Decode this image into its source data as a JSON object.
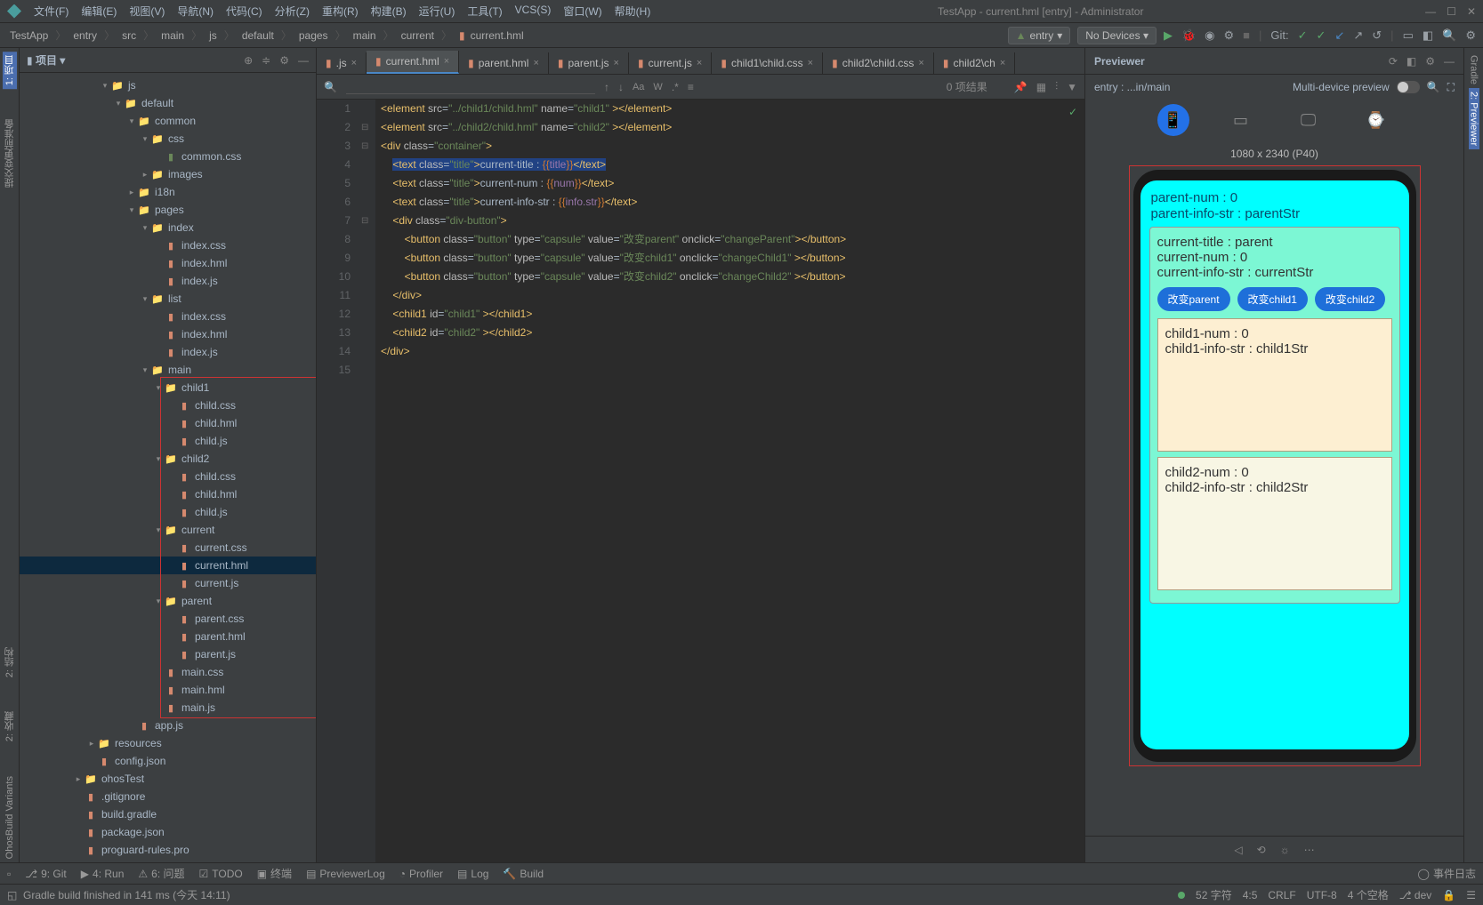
{
  "titlebar": {
    "title": "TestApp - current.hml [entry] - Administrator"
  },
  "menu": [
    "文件(F)",
    "编辑(E)",
    "视图(V)",
    "导航(N)",
    "代码(C)",
    "分析(Z)",
    "重构(R)",
    "构建(B)",
    "运行(U)",
    "工具(T)",
    "VCS(S)",
    "窗口(W)",
    "帮助(H)"
  ],
  "breadcrumb": [
    "TestApp",
    "entry",
    "src",
    "main",
    "js",
    "default",
    "pages",
    "main",
    "current",
    "current.hml"
  ],
  "right_tools": {
    "entry": "entry",
    "devices": "No Devices ▾",
    "git": "Git:"
  },
  "left_rail": [
    "1: 项目",
    "提交变更前准备",
    "2: 结构",
    "2: 收藏",
    "OhosBuild Variants"
  ],
  "right_rail": [
    "Gradle",
    "2: Previewer"
  ],
  "project": {
    "title": "项目 ▾"
  },
  "tree": [
    {
      "indent": 90,
      "caret": "▾",
      "ico": "folder",
      "name": "js"
    },
    {
      "indent": 105,
      "caret": "▾",
      "ico": "folder",
      "name": "default"
    },
    {
      "indent": 120,
      "caret": "▾",
      "ico": "folder",
      "name": "common"
    },
    {
      "indent": 135,
      "caret": "▾",
      "ico": "folder",
      "name": "css"
    },
    {
      "indent": 150,
      "caret": "",
      "ico": "css",
      "name": "common.css",
      "green": true
    },
    {
      "indent": 135,
      "caret": "▸",
      "ico": "folder",
      "name": "images"
    },
    {
      "indent": 120,
      "caret": "▸",
      "ico": "folder",
      "name": "i18n"
    },
    {
      "indent": 120,
      "caret": "▾",
      "ico": "folder",
      "name": "pages"
    },
    {
      "indent": 135,
      "caret": "▾",
      "ico": "folder",
      "name": "index"
    },
    {
      "indent": 150,
      "caret": "",
      "ico": "css",
      "name": "index.css"
    },
    {
      "indent": 150,
      "caret": "",
      "ico": "hml",
      "name": "index.hml"
    },
    {
      "indent": 150,
      "caret": "",
      "ico": "js",
      "name": "index.js"
    },
    {
      "indent": 135,
      "caret": "▾",
      "ico": "folder",
      "name": "list"
    },
    {
      "indent": 150,
      "caret": "",
      "ico": "css",
      "name": "index.css"
    },
    {
      "indent": 150,
      "caret": "",
      "ico": "hml",
      "name": "index.hml"
    },
    {
      "indent": 150,
      "caret": "",
      "ico": "js",
      "name": "index.js"
    },
    {
      "indent": 135,
      "caret": "▾",
      "ico": "folder",
      "name": "main"
    },
    {
      "indent": 150,
      "caret": "▾",
      "ico": "folder",
      "name": "child1"
    },
    {
      "indent": 165,
      "caret": "",
      "ico": "css",
      "name": "child.css"
    },
    {
      "indent": 165,
      "caret": "",
      "ico": "hml",
      "name": "child.hml"
    },
    {
      "indent": 165,
      "caret": "",
      "ico": "js",
      "name": "child.js"
    },
    {
      "indent": 150,
      "caret": "▾",
      "ico": "folder",
      "name": "child2"
    },
    {
      "indent": 165,
      "caret": "",
      "ico": "css",
      "name": "child.css"
    },
    {
      "indent": 165,
      "caret": "",
      "ico": "hml",
      "name": "child.hml"
    },
    {
      "indent": 165,
      "caret": "",
      "ico": "js",
      "name": "child.js"
    },
    {
      "indent": 150,
      "caret": "▾",
      "ico": "folder",
      "name": "current"
    },
    {
      "indent": 165,
      "caret": "",
      "ico": "css",
      "name": "current.css"
    },
    {
      "indent": 165,
      "caret": "",
      "ico": "hml",
      "name": "current.hml",
      "selected": true
    },
    {
      "indent": 165,
      "caret": "",
      "ico": "js",
      "name": "current.js"
    },
    {
      "indent": 150,
      "caret": "▾",
      "ico": "folder",
      "name": "parent"
    },
    {
      "indent": 165,
      "caret": "",
      "ico": "css",
      "name": "parent.css"
    },
    {
      "indent": 165,
      "caret": "",
      "ico": "hml",
      "name": "parent.hml"
    },
    {
      "indent": 165,
      "caret": "",
      "ico": "js",
      "name": "parent.js"
    },
    {
      "indent": 150,
      "caret": "",
      "ico": "css",
      "name": "main.css"
    },
    {
      "indent": 150,
      "caret": "",
      "ico": "hml",
      "name": "main.hml"
    },
    {
      "indent": 150,
      "caret": "",
      "ico": "js",
      "name": "main.js"
    },
    {
      "indent": 120,
      "caret": "",
      "ico": "js",
      "name": "app.js"
    },
    {
      "indent": 75,
      "caret": "▸",
      "ico": "folder",
      "name": "resources"
    },
    {
      "indent": 75,
      "caret": "",
      "ico": "json",
      "name": "config.json"
    },
    {
      "indent": 60,
      "caret": "▸",
      "ico": "folder",
      "name": "ohosTest"
    },
    {
      "indent": 60,
      "caret": "",
      "ico": "file",
      "name": ".gitignore"
    },
    {
      "indent": 60,
      "caret": "",
      "ico": "file",
      "name": "build.gradle"
    },
    {
      "indent": 60,
      "caret": "",
      "ico": "file",
      "name": "package.json"
    },
    {
      "indent": 60,
      "caret": "",
      "ico": "file",
      "name": "proguard-rules.pro"
    }
  ],
  "tabs": [
    {
      "name": ".js",
      "ico": "js"
    },
    {
      "name": "current.hml",
      "ico": "hml",
      "active": true
    },
    {
      "name": "parent.hml",
      "ico": "hml"
    },
    {
      "name": "parent.js",
      "ico": "js"
    },
    {
      "name": "current.js",
      "ico": "js"
    },
    {
      "name": "child1\\child.css",
      "ico": "css"
    },
    {
      "name": "child2\\child.css",
      "ico": "css"
    },
    {
      "name": "child2\\ch",
      "ico": "css"
    }
  ],
  "find": {
    "result": "0 项结果"
  },
  "code_lines": [
    1,
    2,
    3,
    4,
    5,
    6,
    7,
    8,
    9,
    10,
    11,
    12,
    13,
    14,
    15
  ],
  "previewer": {
    "title": "Previewer",
    "sub": "entry : ...in/main",
    "multi": "Multi-device preview",
    "dim": "1080 x 2340 (P40)"
  },
  "preview": {
    "p1": "parent-num : 0",
    "p2": "parent-info-str : parentStr",
    "c1": "current-title : parent",
    "c2": "current-num : 0",
    "c3": "current-info-str : currentStr",
    "b1": "改变parent",
    "b2": "改变child1",
    "b3": "改变child2",
    "ch1a": "child1-num : 0",
    "ch1b": "child1-info-str : child1Str",
    "ch2a": "child2-num : 0",
    "ch2b": "child2-info-str : child2Str"
  },
  "bottom": [
    "9: Git",
    "4: Run",
    "6: 问题",
    "TODO",
    "终端",
    "PreviewerLog",
    "Profiler",
    "Log",
    "Build"
  ],
  "bottom_right": "事件日志",
  "status": {
    "left": "Gradle build finished in 141 ms (今天 14:11)",
    "chars": "52 字符",
    "pos": "4:5",
    "crlf": "CRLF",
    "enc": "UTF-8",
    "spaces": "4 个空格",
    "branch": "dev"
  }
}
